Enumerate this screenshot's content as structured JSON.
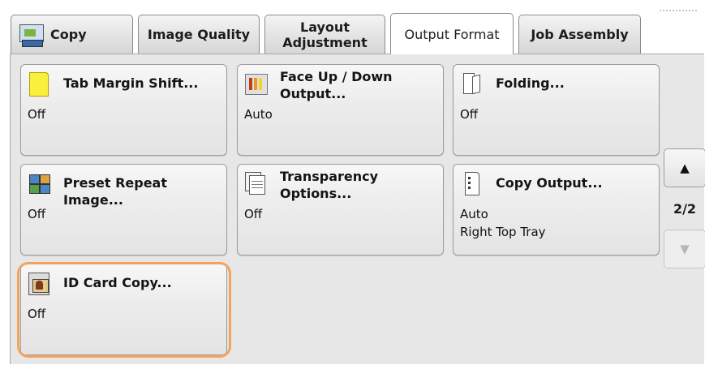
{
  "tabs": [
    {
      "label": "Copy",
      "icon": "copy-icon",
      "active": false
    },
    {
      "label": "Image Quality",
      "active": false
    },
    {
      "label": "Layout\nAdjustment",
      "active": false
    },
    {
      "label": "Output Format",
      "active": true
    },
    {
      "label": "Job Assembly",
      "active": false
    }
  ],
  "buttons": {
    "tab_margin_shift": {
      "title": "Tab Margin Shift...",
      "value": "Off",
      "icon": "tab-paper-icon"
    },
    "face_up_down": {
      "title": "Face Up / Down\nOutput...",
      "value": "Auto",
      "icon": "face-up-down-icon"
    },
    "folding": {
      "title": "Folding...",
      "value": "Off",
      "icon": "folding-icon"
    },
    "preset_repeat": {
      "title": "Preset Repeat Image...",
      "value": "Off",
      "icon": "preset-repeat-icon"
    },
    "transparency": {
      "title": "Transparency\nOptions...",
      "value": "Off",
      "icon": "transparency-icon"
    },
    "copy_output": {
      "title": "Copy Output...",
      "value": "Auto",
      "value2": "Right Top Tray",
      "icon": "copy-output-icon"
    },
    "id_card": {
      "title": "ID Card Copy...",
      "value": "Off",
      "icon": "id-card-icon"
    }
  },
  "pager": {
    "up": "▲",
    "page": "2/2",
    "down": "▼"
  },
  "colors": {
    "highlight": "#f2a45e",
    "panel": "#e7e7e7"
  }
}
